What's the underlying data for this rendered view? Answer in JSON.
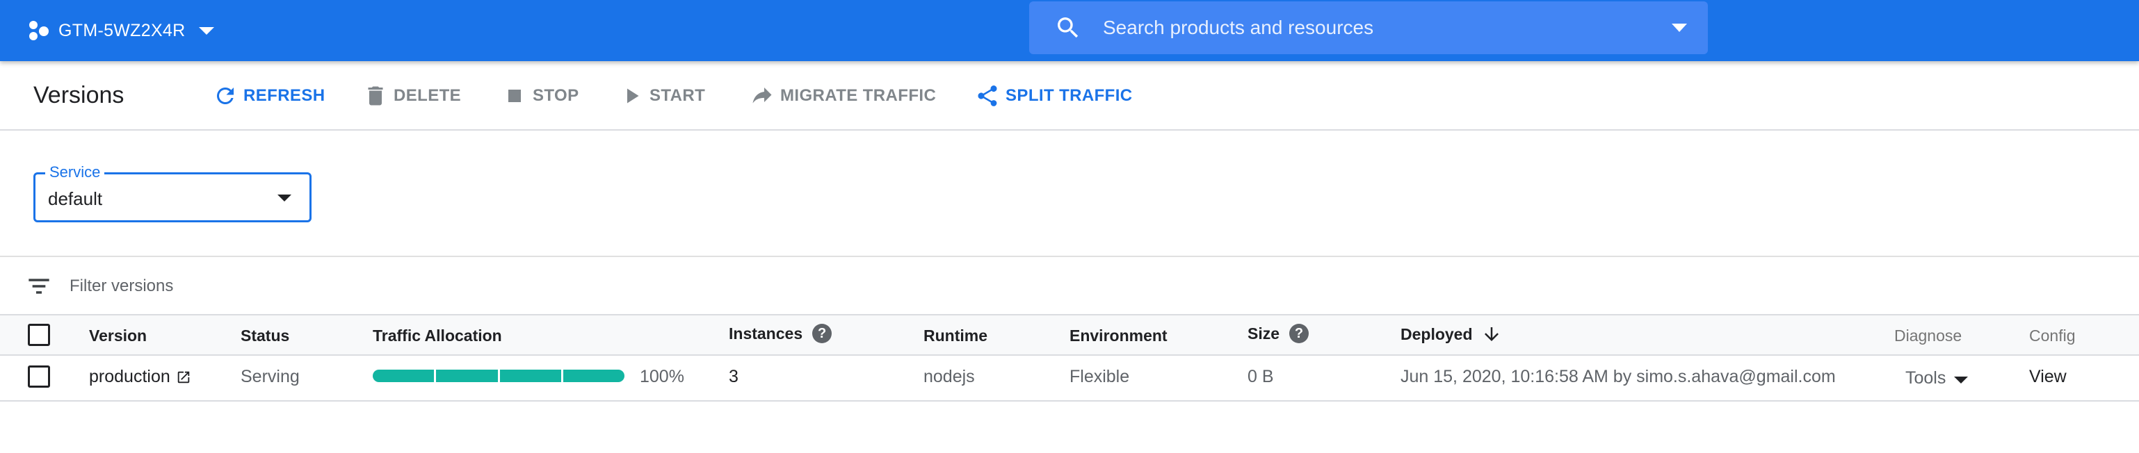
{
  "topbar": {
    "project_name": "GTM-5WZ2X4R",
    "search_placeholder": "Search products and resources"
  },
  "actionbar": {
    "title": "Versions",
    "refresh_label": "REFRESH",
    "delete_label": "DELETE",
    "stop_label": "STOP",
    "start_label": "START",
    "migrate_label": "MIGRATE TRAFFIC",
    "split_label": "SPLIT TRAFFIC"
  },
  "service": {
    "label": "Service",
    "value": "default"
  },
  "filter": {
    "placeholder": "Filter versions"
  },
  "table": {
    "headers": {
      "version": "Version",
      "status": "Status",
      "traffic": "Traffic Allocation",
      "instances": "Instances",
      "runtime": "Runtime",
      "environment": "Environment",
      "size": "Size",
      "deployed": "Deployed",
      "diagnose": "Diagnose",
      "config": "Config"
    },
    "rows": [
      {
        "version": "production",
        "status": "Serving",
        "traffic_percent": "100%",
        "traffic_fraction": 1.0,
        "instances": "3",
        "runtime": "nodejs",
        "environment": "Flexible",
        "size": "0 B",
        "deployed": "Jun 15, 2020, 10:16:58 AM by simo.s.ahava@gmail.com",
        "diagnose": "Tools",
        "config": "View"
      }
    ]
  },
  "colors": {
    "brand_blue": "#1a73e8",
    "traffic_teal": "#12b5a1"
  }
}
